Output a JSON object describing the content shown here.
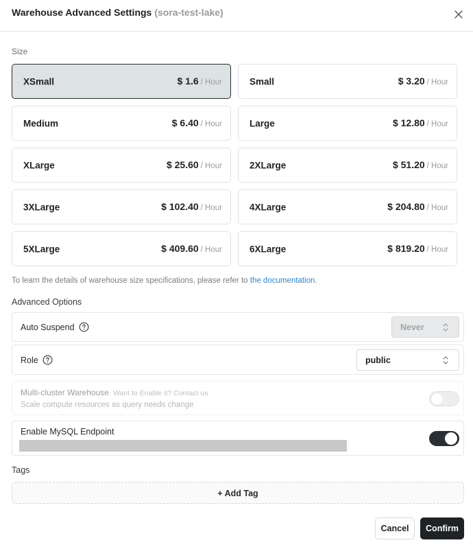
{
  "dialog": {
    "title": "Warehouse Advanced Settings",
    "subtitle": "(sora-test-lake)",
    "close_icon": "close-icon"
  },
  "size": {
    "label": "Size",
    "selected": "XSmall",
    "options": [
      {
        "name": "XSmall",
        "price": "$ 1.6",
        "unit": "/ Hour"
      },
      {
        "name": "Small",
        "price": "$ 3.20",
        "unit": "/ Hour"
      },
      {
        "name": "Medium",
        "price": "$ 6.40",
        "unit": "/ Hour"
      },
      {
        "name": "Large",
        "price": "$ 12.80",
        "unit": "/ Hour"
      },
      {
        "name": "XLarge",
        "price": "$ 25.60",
        "unit": "/ Hour"
      },
      {
        "name": "2XLarge",
        "price": "$ 51.20",
        "unit": "/ Hour"
      },
      {
        "name": "3XLarge",
        "price": "$ 102.40",
        "unit": "/ Hour"
      },
      {
        "name": "4XLarge",
        "price": "$ 204.80",
        "unit": "/ Hour"
      },
      {
        "name": "5XLarge",
        "price": "$ 409.60",
        "unit": "/ Hour"
      },
      {
        "name": "6XLarge",
        "price": "$ 819.20",
        "unit": "/ Hour"
      }
    ]
  },
  "info": {
    "text": "To learn the details of warehouse size specifications, please refer to ",
    "link": "the documentation",
    "suffix": "."
  },
  "advanced": {
    "label": "Advanced Options",
    "auto_suspend": {
      "label": "Auto Suspend",
      "value": "Never",
      "disabled": true
    },
    "role": {
      "label": "Role",
      "value": "public"
    },
    "multi_cluster": {
      "label": "Multi-cluster Warehouse",
      "note": "Want to Enable it? Contact us",
      "description": "Scale compute resources as query needs change",
      "enabled": false
    },
    "mysql_endpoint": {
      "label": "Enable MySQL Endpoint",
      "enabled": true
    }
  },
  "tags": {
    "label": "Tags",
    "add_label": "+ Add Tag"
  },
  "footer": {
    "cancel_label": "Cancel",
    "confirm_label": "Confirm"
  },
  "colors": {
    "accent_link": "#2f86c9",
    "selected_bg": "#dde2e5",
    "primary_button": "#1f2326"
  }
}
